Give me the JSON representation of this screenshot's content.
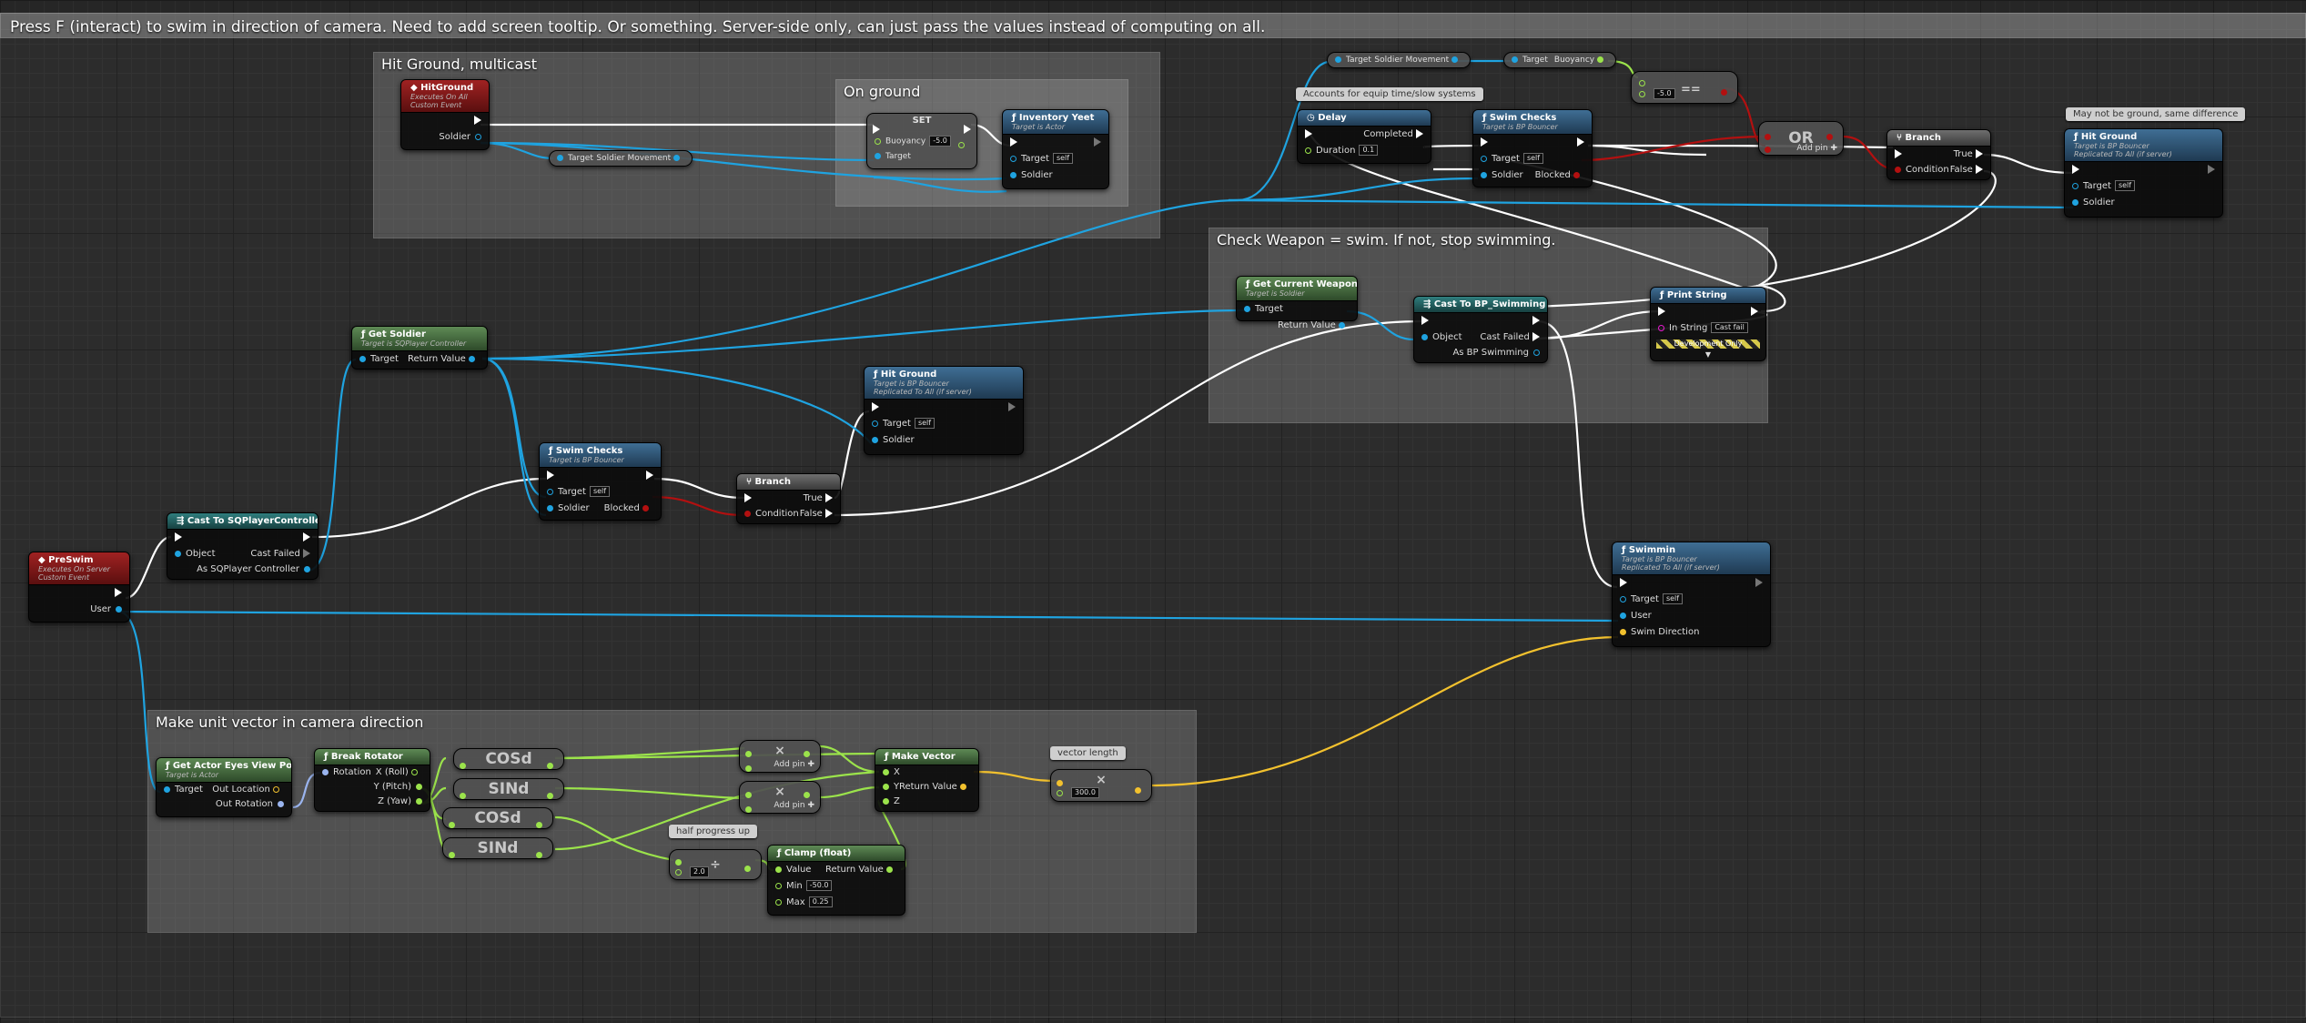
{
  "comments": {
    "top": "Press F (interact) to swim in direction of camera. Need to add screen tooltip. Or something. Server-side only, can just pass the values instead of computing on all.",
    "hit_ground_multicast": "Hit Ground, multicast",
    "on_ground": "On ground",
    "check_weapon": "Check Weapon = swim. If not, stop swimming.",
    "unit_vector": "Make unit vector in camera direction"
  },
  "bubbles": {
    "equip": "Accounts for equip time/slow systems",
    "not_ground": "May not be ground, same difference",
    "vector_length": "vector length",
    "half_progress": "half progress up"
  },
  "nodes": {
    "hitground_event": {
      "title": "HitGround",
      "sub1": "Executes On All",
      "sub2": "Custom Event",
      "soldier": "Soldier"
    },
    "soldier_movement_1": {
      "target": "Target",
      "out": "Soldier Movement"
    },
    "set_node": {
      "title": "SET",
      "buoyancy": "Buoyancy",
      "buoyancy_val": "-5.0",
      "target": "Target"
    },
    "inventory_yeet": {
      "title": "Inventory Yeet",
      "sub": "Target is Actor",
      "target": "Target",
      "target_val": "self",
      "soldier": "Soldier"
    },
    "soldier_movement_2": {
      "target": "Target",
      "out": "Soldier Movement"
    },
    "buoyancy_get": {
      "target": "Target",
      "out": "Buoyancy"
    },
    "equals": {
      "label": "==",
      "val": "-5.0"
    },
    "delay": {
      "title": "Delay",
      "completed": "Completed",
      "duration": "Duration",
      "duration_val": "0.1"
    },
    "swim_checks_top": {
      "title": "Swim Checks",
      "sub": "Target is BP Bouncer",
      "target": "Target",
      "target_val": "self",
      "blocked": "Blocked",
      "soldier": "Soldier"
    },
    "or_node": {
      "title": "OR",
      "add_pin": "Add pin"
    },
    "branch_top": {
      "title": "Branch",
      "true": "True",
      "false": "False",
      "condition": "Condition"
    },
    "hit_ground_top": {
      "title": "Hit Ground",
      "sub1": "Target is BP Bouncer",
      "sub2": "Replicated To All (if server)",
      "target": "Target",
      "target_val": "self",
      "soldier": "Soldier"
    },
    "get_current_weapon": {
      "title": "Get Current Weapon",
      "sub": "Target is Soldier",
      "target": "Target",
      "return": "Return Value"
    },
    "cast_bp_swimming": {
      "title": "Cast To BP_Swimming",
      "object": "Object",
      "cast_failed": "Cast Failed",
      "as": "As BP Swimming"
    },
    "print_string": {
      "title": "Print String",
      "in_string": "In String",
      "in_string_val": "Cast fail",
      "dev": "Development Only"
    },
    "get_soldier": {
      "title": "Get Soldier",
      "sub": "Target is SQPlayer Controller",
      "target": "Target",
      "return": "Return Value"
    },
    "hit_ground_mid": {
      "title": "Hit Ground",
      "sub1": "Target is BP Bouncer",
      "sub2": "Replicated To All (if server)",
      "target": "Target",
      "target_val": "self",
      "soldier": "Soldier"
    },
    "swim_checks_mid": {
      "title": "Swim Checks",
      "sub": "Target is BP Bouncer",
      "target": "Target",
      "target_val": "self",
      "blocked": "Blocked",
      "soldier": "Soldier"
    },
    "branch_mid": {
      "title": "Branch",
      "true": "True",
      "false": "False",
      "condition": "Condition"
    },
    "cast_sq": {
      "title": "Cast To SQPlayerController",
      "object": "Object",
      "cast_failed": "Cast Failed",
      "as": "As SQPlayer Controller"
    },
    "preswim": {
      "title": "PreSwim",
      "sub1": "Executes On Server",
      "sub2": "Custom Event",
      "user": "User"
    },
    "swimmin": {
      "title": "Swimmin",
      "sub1": "Target is BP Bouncer",
      "sub2": "Replicated To All (if server)",
      "target": "Target",
      "target_val": "self",
      "user": "User",
      "swim_direction": "Swim Direction"
    },
    "get_actor_eyes": {
      "title": "Get Actor Eyes View Point",
      "sub": "Target is Actor",
      "target": "Target",
      "out_location": "Out Location",
      "out_rotation": "Out Rotation"
    },
    "break_rotator": {
      "title": "Break Rotator",
      "rotation": "Rotation",
      "x": "X (Roll)",
      "y": "Y (Pitch)",
      "z": "Z (Yaw)"
    },
    "cosd1": {
      "label": "COSd"
    },
    "sind1": {
      "label": "SINd"
    },
    "cosd2": {
      "label": "COSd"
    },
    "sind2": {
      "label": "SINd"
    },
    "mult1": {
      "label": "×",
      "add_pin": "Add pin"
    },
    "mult2": {
      "label": "×",
      "add_pin": "Add pin"
    },
    "make_vector": {
      "title": "Make Vector",
      "x": "X",
      "y": "Y",
      "z": "Z",
      "return": "Return Value"
    },
    "vec_mult": {
      "label": "×",
      "val": "300.0"
    },
    "divide": {
      "label": "÷",
      "val": "2.0"
    },
    "clamp": {
      "title": "Clamp (float)",
      "value": "Value",
      "return": "Return Value",
      "min": "Min",
      "min_val": "-50.0",
      "max": "Max",
      "max_val": "0.25"
    }
  },
  "colors": {
    "exec": "#ffffff",
    "object": "#1fa3e0",
    "bool": "#b31010",
    "float": "#9be34b",
    "vector": "#f2c12e",
    "rotator": "#9ab4ee",
    "string": "#e81ad0"
  }
}
